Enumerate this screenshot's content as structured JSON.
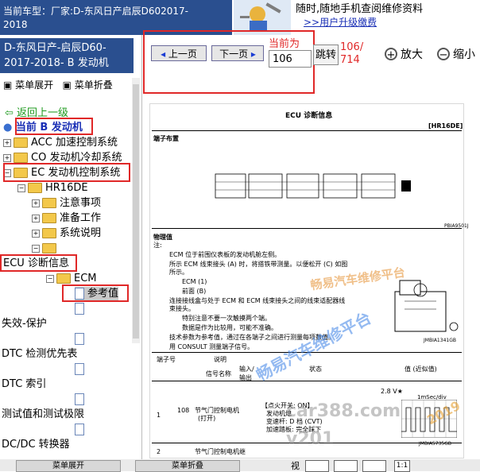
{
  "vehicle": {
    "line1": "当前车型：厂家:D-东风日产启辰D602017-",
    "line2": "2018"
  },
  "ad": {
    "line1": "随时,随地手机查阅维修资料",
    "link": ">>用户升级缴费"
  },
  "sidebar": {
    "header_line1": "D-东风日产-启辰D60-",
    "header_line2": "2017-2018- B 发动机",
    "expand_all": "菜单展开",
    "collapse_all": "菜单折叠",
    "back": "返回上一级",
    "current_prefix": "当前",
    "current": "B 发动机",
    "tree": [
      {
        "label": "ACC 加速控制系统"
      },
      {
        "label": "CO 发动机冷却系统"
      },
      {
        "label": "EC 发动机控制系统"
      },
      {
        "label": "HR16DE"
      },
      {
        "label": "注意事项"
      },
      {
        "label": "准备工作"
      },
      {
        "label": "系统说明"
      },
      {
        "label": "ECU 诊断信息"
      },
      {
        "label": "ECM"
      },
      {
        "label": "参考值"
      },
      {
        "label": "失效-保护"
      },
      {
        "label": "DTC 检测优先表"
      },
      {
        "label": "DTC 索引"
      },
      {
        "label": "测试值和测试极限"
      },
      {
        "label": "DC/DC 转换器"
      }
    ]
  },
  "pager": {
    "prev": "上一页",
    "next": "下一页",
    "current_label": "当前为",
    "page_value": "106",
    "jump": "跳转",
    "page_count_line1": "106/",
    "page_count_line2": "714",
    "zoom_in": "放大",
    "zoom_out": "缩小"
  },
  "document": {
    "title": "ECU 诊断信息",
    "code": "[HR16DE]",
    "section1": "端子布置",
    "ref1": "PBIA9501J",
    "section2": "物理值",
    "note": "注:",
    "b1": "ECM 位于前围仪表板的发动机舱左侧。",
    "b2": "所示 ECM 线束接头 (A) 时，将搭铁带测量。以便松开 (C) 如图",
    "b2b": "所示。",
    "b3": "ECM (1)",
    "b4": "前面 (B)",
    "b5": "连接接线盒与处于 ECM 和 ECM 线束接头之间的线束适配器线",
    "b5b": "束接头。",
    "b6": "特别注意不要一次触摸两个端。",
    "b7": "数据是作为比较用，可能不准确。",
    "b8": "技术参数为参考值，通过在各端子之间进行测量每项数值。",
    "b9": "用 CONSULT 测量端子信号。",
    "ref2": "JMBIA1341GB",
    "table_h1": "端子号",
    "table_h2": "说明",
    "table_h3": "信号名称",
    "table_h4": "输入/输出",
    "table_h5": "状态",
    "table_h6": "值 (近似值)",
    "row1_a": "1",
    "row1_b": "108",
    "row1_c": "节气门控制电机",
    "row1_d": "(打开)",
    "row1_e": "【点火开关: ON】",
    "row1_f": "发动机熄",
    "row1_g": "变速杆: D 档 (CVT)",
    "row1_h": "加速踏板: 完全踩下",
    "voltage": "2.8 V★",
    "scale": "1mSec/div",
    "ref3": "JMBIA5735GB",
    "row2_a": "2",
    "row2_c": "节气门控制电机继"
  },
  "watermarks": {
    "w1": "畅易汽车维修平台",
    "w2": "畅易汽车维修平台",
    "w3": "car388.com",
    "w4": "2019",
    "w5": "v201"
  },
  "bottom": {
    "btn1": "菜单展开",
    "btn2": "菜单折叠",
    "view": "视",
    "scale": "1:1"
  }
}
